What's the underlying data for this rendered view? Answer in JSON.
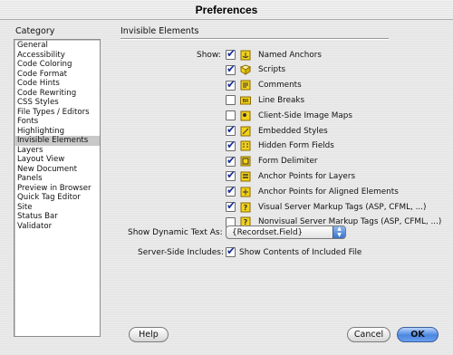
{
  "window": {
    "title": "Preferences"
  },
  "category": {
    "header": "Category",
    "items": [
      "General",
      "Accessibility",
      "Code Coloring",
      "Code Format",
      "Code Hints",
      "Code Rewriting",
      "CSS Styles",
      "File Types / Editors",
      "Fonts",
      "Highlighting",
      "Invisible Elements",
      "Layers",
      "Layout View",
      "New Document",
      "Panels",
      "Preview in Browser",
      "Quick Tag Editor",
      "Site",
      "Status Bar",
      "Validator"
    ],
    "selected": "Invisible Elements"
  },
  "panel": {
    "title": "Invisible Elements",
    "show_label": "Show:",
    "options": [
      {
        "label": "Named Anchors",
        "checked": true,
        "icon": "anchor-icon"
      },
      {
        "label": "Scripts",
        "checked": true,
        "icon": "script-icon"
      },
      {
        "label": "Comments",
        "checked": true,
        "icon": "comment-icon"
      },
      {
        "label": "Line Breaks",
        "checked": false,
        "icon": "line-break-icon"
      },
      {
        "label": "Client-Side Image Maps",
        "checked": false,
        "icon": "image-map-icon"
      },
      {
        "label": "Embedded Styles",
        "checked": true,
        "icon": "embedded-style-icon"
      },
      {
        "label": "Hidden Form Fields",
        "checked": true,
        "icon": "hidden-field-icon"
      },
      {
        "label": "Form Delimiter",
        "checked": true,
        "icon": "form-delimiter-icon"
      },
      {
        "label": "Anchor Points for Layers",
        "checked": true,
        "icon": "layer-anchor-icon"
      },
      {
        "label": "Anchor Points for Aligned Elements",
        "checked": true,
        "icon": "aligned-anchor-icon"
      },
      {
        "label": "Visual Server Markup Tags (ASP, CFML, ...)",
        "checked": true,
        "icon": "server-tag-icon"
      },
      {
        "label": "Nonvisual Server Markup Tags (ASP, CFML, ...)",
        "checked": false,
        "icon": "server-tag-icon"
      }
    ],
    "dynamic_text": {
      "label": "Show Dynamic Text As:",
      "value": "{Recordset.Field}"
    },
    "ssi": {
      "label": "Server-Side Includes:",
      "option_label": "Show Contents of Included File",
      "checked": true
    }
  },
  "buttons": {
    "help": "Help",
    "cancel": "Cancel",
    "ok": "OK"
  },
  "colors": {
    "check": "#1a2e9a",
    "icon_yellow": "#f2d21a",
    "ok_button": "#4b86e0"
  }
}
